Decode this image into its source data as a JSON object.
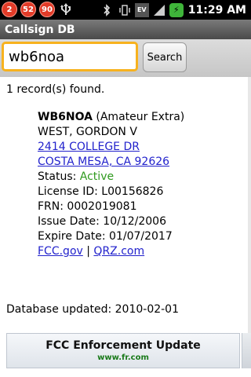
{
  "status_bar": {
    "badges": [
      "2",
      "52",
      "90"
    ],
    "time": "11:29 AM",
    "network_label": "EV"
  },
  "app": {
    "title": "Callsign DB"
  },
  "search": {
    "value": "wb6noa",
    "button_label": "Search"
  },
  "results": {
    "summary": "1 record(s) found.",
    "record": {
      "callsign": "WB6NOA",
      "license_class": "(Amateur Extra)",
      "name": "WEST, GORDON V",
      "address_line1": "2414 COLLEGE DR",
      "address_line2": "COSTA MESA, CA 92626",
      "status_label": "Status:",
      "status_value": "Active",
      "license_id": "License ID: L00156826",
      "frn": "FRN: 0002019081",
      "issue_date": "Issue Date: 10/12/2006",
      "expire_date": "Expire Date: 01/07/2017",
      "link_fcc": "FCC.gov",
      "link_separator": "|",
      "link_qrz": "QRZ.com"
    }
  },
  "database_updated": "Database updated: 2010-02-01",
  "ad": {
    "title": "FCC Enforcement Update",
    "url": "www.fr.com"
  },
  "colors": {
    "status_active": "#2f9a1e",
    "link": "#2222cc",
    "focus_border": "#f7b21e"
  }
}
